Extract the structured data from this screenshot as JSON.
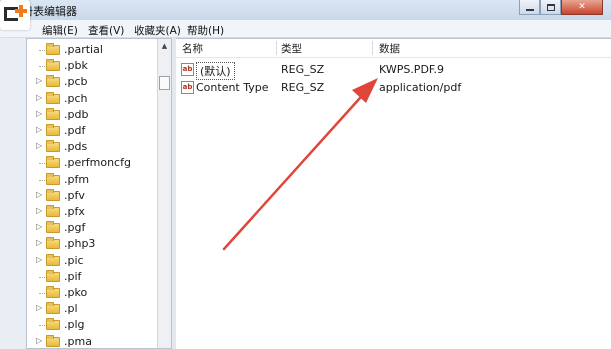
{
  "window": {
    "title": "册表编辑器"
  },
  "menu": [
    "编辑(E)",
    "查看(V)",
    "收藏夹(A)",
    "帮助(H)"
  ],
  "tree": {
    "items": [
      {
        "label": ".partial",
        "expandable": false
      },
      {
        "label": ".pbk",
        "expandable": false
      },
      {
        "label": ".pcb",
        "expandable": true
      },
      {
        "label": ".pch",
        "expandable": true
      },
      {
        "label": ".pdb",
        "expandable": true
      },
      {
        "label": ".pdf",
        "expandable": true
      },
      {
        "label": ".pds",
        "expandable": true
      },
      {
        "label": ".perfmoncfg",
        "expandable": false
      },
      {
        "label": ".pfm",
        "expandable": false
      },
      {
        "label": ".pfv",
        "expandable": true
      },
      {
        "label": ".pfx",
        "expandable": true
      },
      {
        "label": ".pgf",
        "expandable": true
      },
      {
        "label": ".php3",
        "expandable": true
      },
      {
        "label": ".pic",
        "expandable": true
      },
      {
        "label": ".pif",
        "expandable": false
      },
      {
        "label": ".pko",
        "expandable": false
      },
      {
        "label": ".pl",
        "expandable": true
      },
      {
        "label": ".plg",
        "expandable": false
      },
      {
        "label": ".pma",
        "expandable": true
      }
    ]
  },
  "list": {
    "headers": {
      "name": "名称",
      "type": "类型",
      "data": "数据"
    },
    "rows": [
      {
        "icon": "ab",
        "name": "(默认)",
        "type": "REG_SZ",
        "data": "KWPS.PDF.9",
        "selected": true
      },
      {
        "icon": "ab",
        "name": "Content Type",
        "type": "REG_SZ",
        "data": "application/pdf",
        "selected": false
      }
    ]
  },
  "colors": {
    "arrow": "#e0453a",
    "folder": "#e7b93a",
    "selection_border": "#555555"
  },
  "icons": [
    "logo-icon",
    "folder-icon",
    "string-value-icon",
    "minimize-icon",
    "maximize-icon",
    "close-icon",
    "scroll-up-icon",
    "annotation-arrow-icon"
  ]
}
